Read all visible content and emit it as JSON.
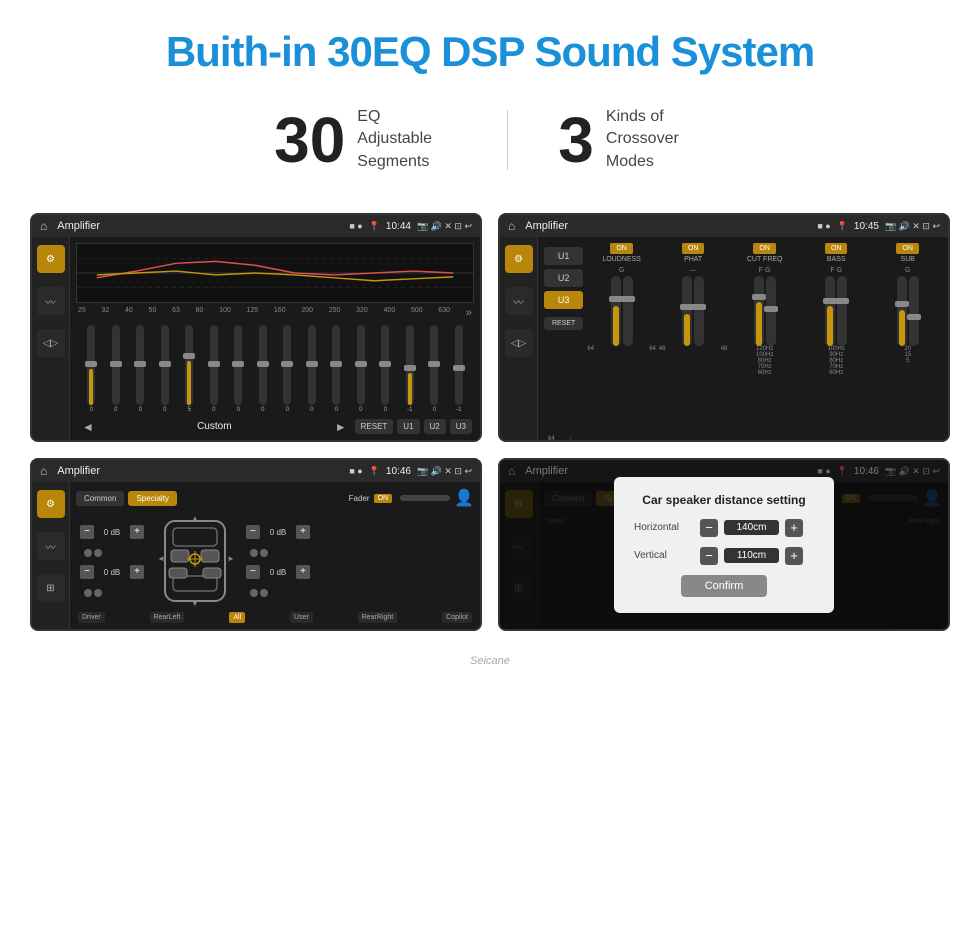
{
  "page": {
    "title": "Buith-in 30EQ DSP Sound System",
    "stats": [
      {
        "number": "30",
        "desc": "EQ Adjustable\nSegments"
      },
      {
        "number": "3",
        "desc": "Kinds of\nCrossover Modes"
      }
    ]
  },
  "screens": [
    {
      "id": "screen1",
      "statusBar": {
        "title": "Amplifier",
        "time": "10:44"
      },
      "freqLabels": [
        "25",
        "32",
        "40",
        "50",
        "63",
        "80",
        "100",
        "125",
        "160",
        "200",
        "250",
        "320",
        "400",
        "500",
        "630"
      ],
      "sliderValues": [
        "0",
        "0",
        "0",
        "0",
        "5",
        "0",
        "0",
        "0",
        "0",
        "0",
        "0",
        "0",
        "0",
        "-1",
        "0",
        "-1"
      ],
      "presetName": "Custom",
      "bottomBtns": [
        "RESET",
        "U1",
        "U2",
        "U3"
      ]
    },
    {
      "id": "screen2",
      "statusBar": {
        "title": "Amplifier",
        "time": "10:45"
      },
      "presets": [
        "U1",
        "U2",
        "U3"
      ],
      "activePreset": "U3",
      "channels": [
        {
          "name": "LOUDNESS",
          "on": true
        },
        {
          "name": "PHAT",
          "on": true
        },
        {
          "name": "CUT FREQ",
          "on": true
        },
        {
          "name": "BASS",
          "on": true
        },
        {
          "name": "SUB",
          "on": true
        }
      ],
      "resetBtn": "RESET"
    },
    {
      "id": "screen3",
      "statusBar": {
        "title": "Amplifier",
        "time": "10:46"
      },
      "presetBtns": [
        "Common",
        "Specialty"
      ],
      "activePreset": "Specialty",
      "faderLabel": "Fader",
      "faderOn": "ON",
      "controls": [
        {
          "label": "0 dB"
        },
        {
          "label": "0 dB"
        },
        {
          "label": "0 dB"
        },
        {
          "label": "0 dB"
        }
      ],
      "speakerPositions": [
        "Driver",
        "RearLeft",
        "All",
        "User",
        "RearRight",
        "Copilot"
      ]
    },
    {
      "id": "screen4",
      "statusBar": {
        "title": "Amplifier",
        "time": "10:46"
      },
      "dialog": {
        "title": "Car speaker distance setting",
        "horizontal": {
          "label": "Horizontal",
          "value": "140cm"
        },
        "vertical": {
          "label": "Vertical",
          "value": "110cm"
        },
        "confirmBtn": "Confirm"
      }
    }
  ],
  "watermark": "Seicane"
}
